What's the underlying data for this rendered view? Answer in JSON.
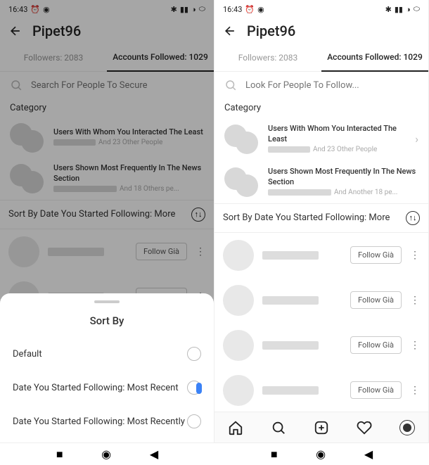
{
  "status": {
    "time": "16:43",
    "alarm": "⏰",
    "pin": "◉",
    "bt": "✱",
    "signal": "📶",
    "wifi": "📶",
    "battery": "⬭"
  },
  "header": {
    "username": "Pipet96"
  },
  "tabs": {
    "followers": "Followers: 2083",
    "following": "Accounts Followed: 1029"
  },
  "search": {
    "placeholder_left": "Search For People To Secure",
    "placeholder_right": "Look For People To Follow..."
  },
  "category": {
    "label": "Category",
    "item1": {
      "title": "Users With Whom You Interacted The Least",
      "sub": "And 23 Other People"
    },
    "item2": {
      "title": "Users Shown Most Frequently In The News Section",
      "sub_left": "And 18 Others pe...",
      "sub_right": "And Another 18 pe..."
    }
  },
  "sort": {
    "text": "Sort By Date You Started Following: More"
  },
  "follow_btn": "Follow Già",
  "sheet": {
    "title": "Sort By",
    "opt1": "Default",
    "opt2": "Date You Started Following: Most Recent",
    "opt3": "Date You Started Following: Most Recently"
  }
}
